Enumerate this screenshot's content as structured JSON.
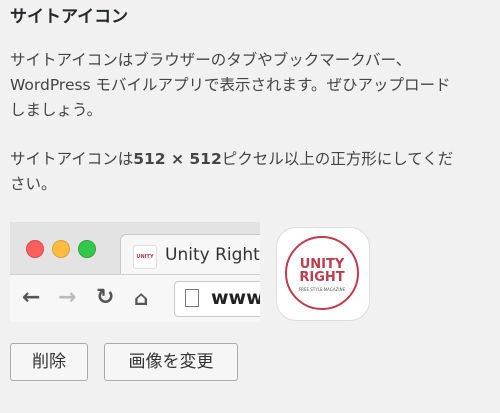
{
  "section": {
    "title": "サイトアイコン",
    "desc1_line1": "サイトアイコンはブラウザーのタブやブックマークバー、",
    "desc1_line2": "WordPress モバイルアプリで表示されます。ぜひアップロード",
    "desc1_line3": "しましょう。",
    "desc2_prefix": "サイトアイコンは",
    "desc2_bold": "512 × 512",
    "desc2_line1_rest": "ピクセル以上の正方形にしてくだ",
    "desc2_line2": "さい。"
  },
  "preview": {
    "tab_title": "Unity Right",
    "tab_favicon_text": "UNITY RIGHT",
    "url_text": "www.",
    "icon_logo_line1": "UNITY",
    "icon_logo_line2": "RIGHT",
    "icon_logo_sub": "FREE STYLE MAGAZINE"
  },
  "buttons": {
    "remove": "削除",
    "change": "画像を変更"
  },
  "icons": {
    "back": "←",
    "forward": "→",
    "reload": "↻",
    "home": "⌂"
  }
}
